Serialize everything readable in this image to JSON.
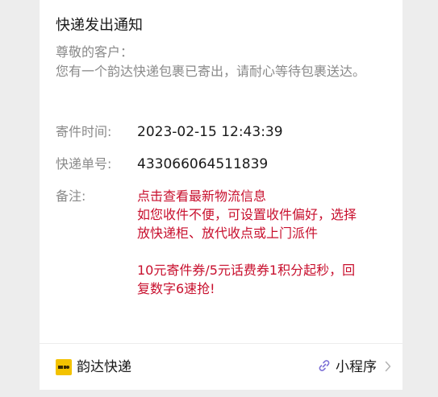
{
  "notice": {
    "title": "快递发出通知",
    "greeting": "尊敬的客户：",
    "message": "您有一个韵达快递包裹已寄出，请耐心等待包裹送达。"
  },
  "fields": {
    "send_time_label": "寄件时间:",
    "send_time_value": "2023-02-15 12:43:39",
    "tracking_label": "快递单号:",
    "tracking_value": "433066064511839",
    "remark_label": "备注:"
  },
  "remark": {
    "line1": "点击查看最新物流信息",
    "line2": "如您收件不便，可设置收件偏好，选择",
    "line3": "放快递柜、放代收点或上门派件",
    "line4": "10元寄件券/5元话费券1积分起秒，回",
    "line5": "复数字6速抢!"
  },
  "footer": {
    "brand_name": "韵达快递",
    "miniprogram_label": "小程序",
    "brand_color": "#f3c200",
    "link_icon_color": "#7b6fd6"
  }
}
